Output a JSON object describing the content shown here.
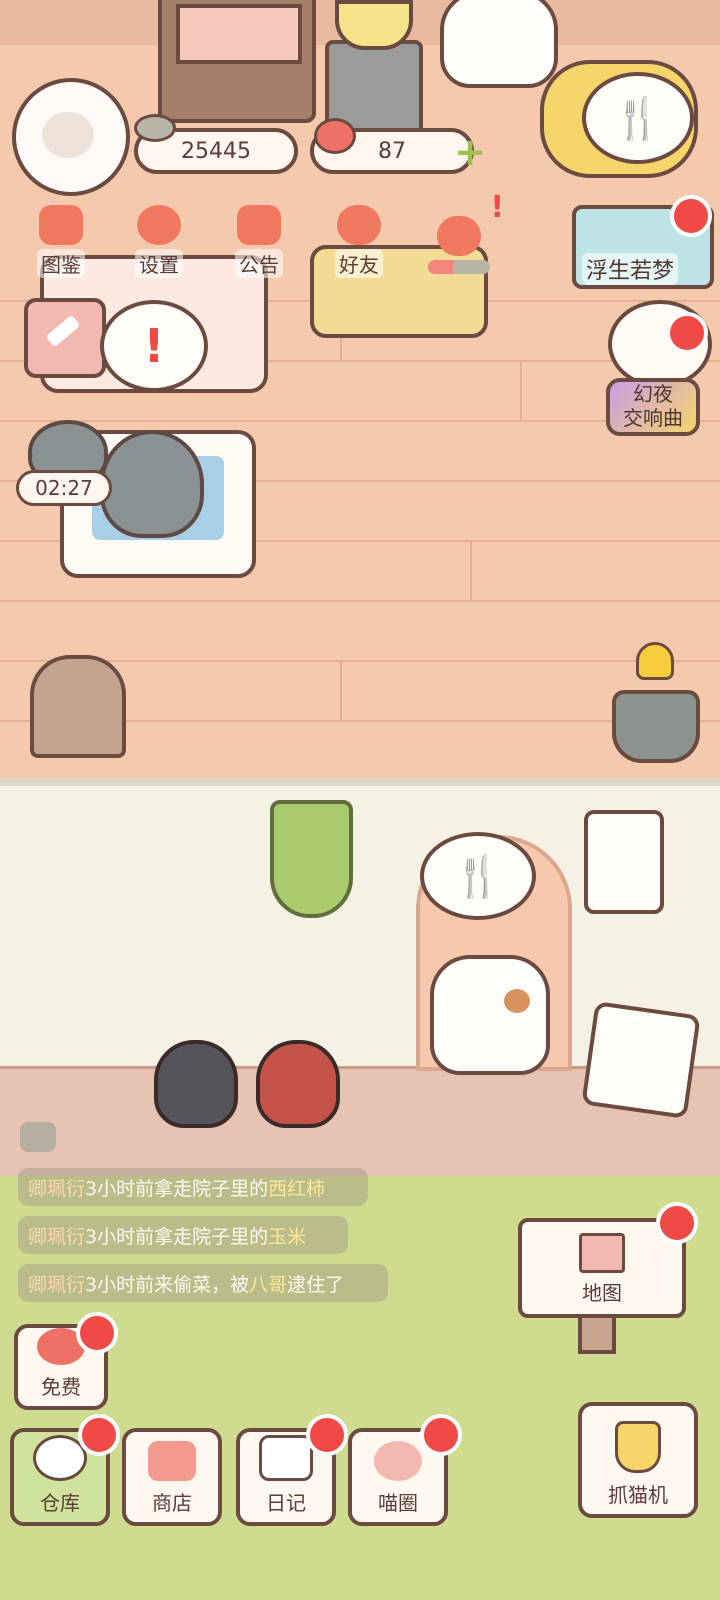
{
  "currencies": {
    "fish": "25445",
    "hearts": "87"
  },
  "top_menu": [
    {
      "label": "图鉴"
    },
    {
      "label": "设置"
    },
    {
      "label": "公告"
    },
    {
      "label": "好友"
    },
    {
      "label": ""
    }
  ],
  "events": {
    "event1": "浮生若梦",
    "event2_line1": "幻夜",
    "event2_line2": "交响曲"
  },
  "timer": "02:27",
  "alert_glyph": "!",
  "feed_glyph": "🍴",
  "logs": [
    {
      "name": "卿珮衍",
      "text": "3小时前拿走院子里的",
      "item": "西红柿",
      "tail": ""
    },
    {
      "name": "卿珮衍",
      "text": "3小时前拿走院子里的",
      "item": "玉米",
      "tail": ""
    },
    {
      "name": "卿珮衍",
      "text": "3小时前来偷菜，被",
      "item": "八哥",
      "tail": "逮住了"
    }
  ],
  "buttons": {
    "map": "地图",
    "free": "免费",
    "warehouse": "仓库",
    "shop": "商店",
    "diary": "日记",
    "circle": "喵圈",
    "claw": "抓猫机"
  },
  "colors": {
    "floor": "#f4c9ae",
    "grass": "#cfdc8f",
    "badge": "#ef4a45",
    "accent": "#f0785f"
  }
}
